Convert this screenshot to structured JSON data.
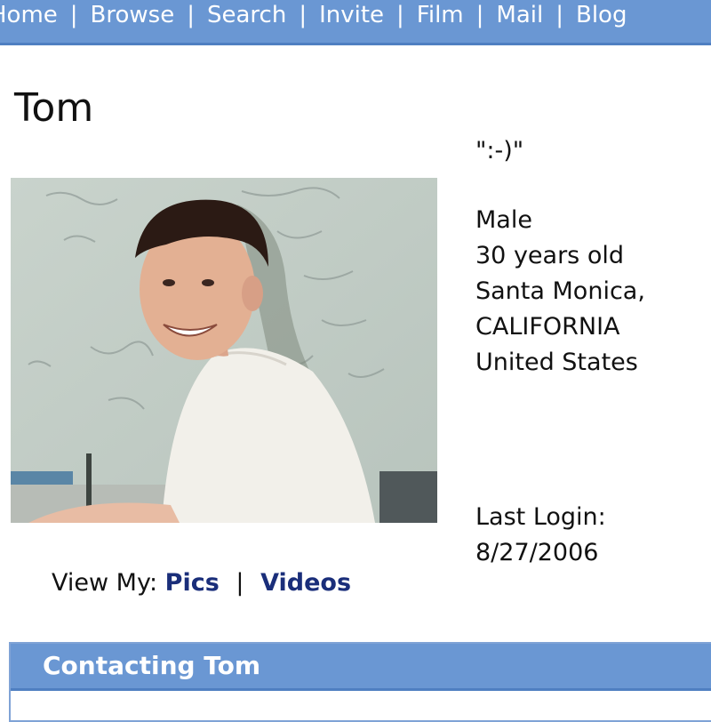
{
  "nav": {
    "items": [
      "Home",
      "Browse",
      "Search",
      "Invite",
      "Film",
      "Mail",
      "Blog"
    ],
    "separator": "|"
  },
  "profile": {
    "name": "Tom",
    "mood": "\":-)\"",
    "gender": "Male",
    "age": "30 years old",
    "city": "Santa Monica,",
    "state": "CALIFORNIA",
    "country": "United States",
    "last_login_label": "Last Login:",
    "last_login_date": "8/27/2006"
  },
  "view_my": {
    "label": "View My:",
    "pics": "Pics",
    "separator": "|",
    "videos": "Videos"
  },
  "contact": {
    "title": "Contacting Tom"
  },
  "colors": {
    "nav_blue": "#6a97d3",
    "link_navy": "#1a2e7a"
  }
}
